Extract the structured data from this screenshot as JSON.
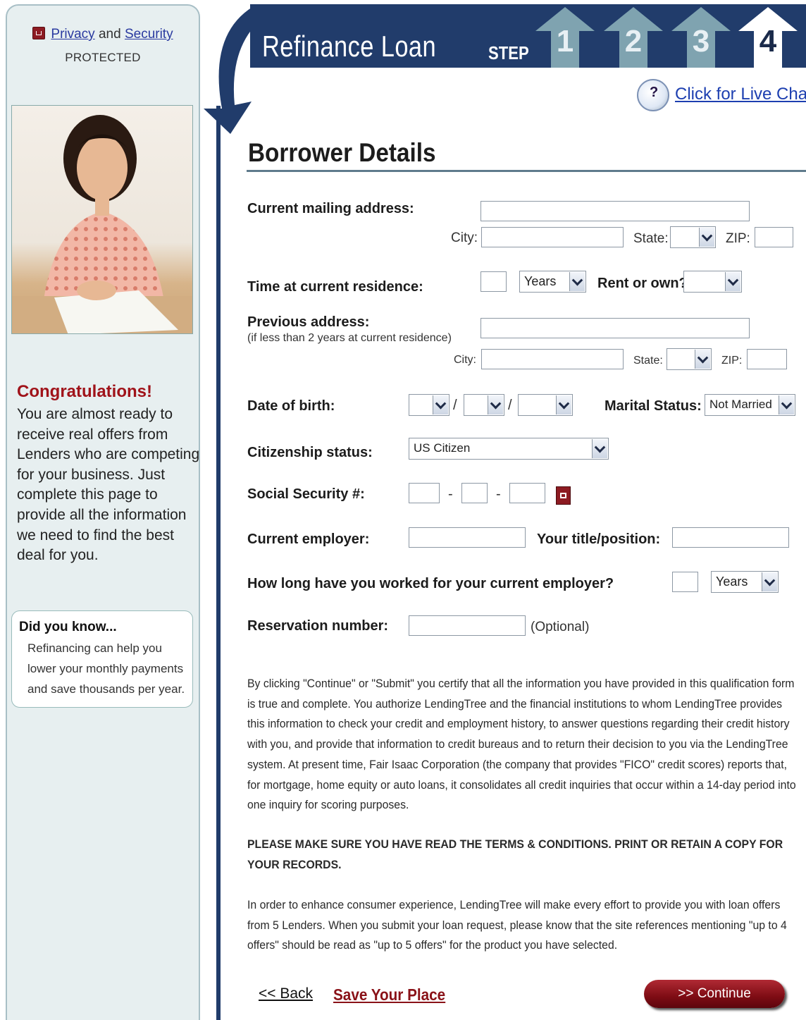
{
  "sidebar": {
    "privacy_link": "Privacy",
    "and": "and",
    "security_link": "Security",
    "protected": "PROTECTED",
    "congrats_title": "Congratulations!",
    "congrats_text": "You are almost ready to receive real offers from Lenders who are competing for your business. Just complete this page to provide all the information we need to find the best deal for you.",
    "did_you_know_title": "Did you know...",
    "did_you_know_text": "Refinancing can help you lower your monthly payments and save thousands per year."
  },
  "header": {
    "title": "Refinance Loan",
    "step_label": "STEP",
    "steps": [
      "1",
      "2",
      "3",
      "4"
    ],
    "current_step": "4",
    "live_chat": "Click for Live Chat"
  },
  "form": {
    "heading": "Borrower Details",
    "mailing_address_label": "Current mailing address:",
    "city_label": "City:",
    "state_label": "State:",
    "zip_label": "ZIP:",
    "time_residence_label": "Time at current residence:",
    "years_option": "Years",
    "rent_own_label": "Rent or own?",
    "previous_address_label": "Previous address:",
    "previous_address_note": "(if less than 2 years at current residence)",
    "dob_label": "Date of birth:",
    "date_sep": "/",
    "marital_label": "Marital Status:",
    "marital_value": "Not Married",
    "citizenship_label": "Citizenship status:",
    "citizenship_value": "US Citizen",
    "ssn_label": "Social Security #:",
    "ssn_sep": "-",
    "employer_label": "Current employer:",
    "title_label": "Your title/position:",
    "how_long_label": "How long have you worked for your current employer?",
    "reservation_label": "Reservation number:",
    "optional": "(Optional)"
  },
  "legal": {
    "para1": "By clicking \"Continue\" or \"Submit\" you certify that all the information you have provided in this qualification form is true and complete. You authorize LendingTree and the financial institutions to whom LendingTree provides this information to check your credit and employment history, to answer questions regarding their credit history with you, and provide that information to credit bureaus and to return their decision to you via the LendingTree system. At present time, Fair Isaac Corporation (the company that provides \"FICO\" credit scores) reports that, for mortgage, home equity or auto loans, it consolidates all credit inquiries that occur within a 14-day period into one inquiry for scoring purposes.",
    "para2": "PLEASE MAKE SURE YOU HAVE READ THE TERMS & CONDITIONS. PRINT OR RETAIN A COPY FOR YOUR RECORDS.",
    "para3": "In order to enhance consumer experience, LendingTree will make every effort to provide you with loan offers from 5 Lenders. When you submit your loan request, please know that the site references mentioning \"up to 4 offers\" should be read as \"up to 5 offers\" for the product you have selected."
  },
  "footer": {
    "back": "<< Back",
    "save_place": "Save Your Place",
    "continue": ">> Continue"
  },
  "colors": {
    "navy": "#213c6b",
    "step_inactive": "#7fa3b0",
    "accent_red": "#a0131a",
    "sidebar_bg": "#e7eff0"
  }
}
